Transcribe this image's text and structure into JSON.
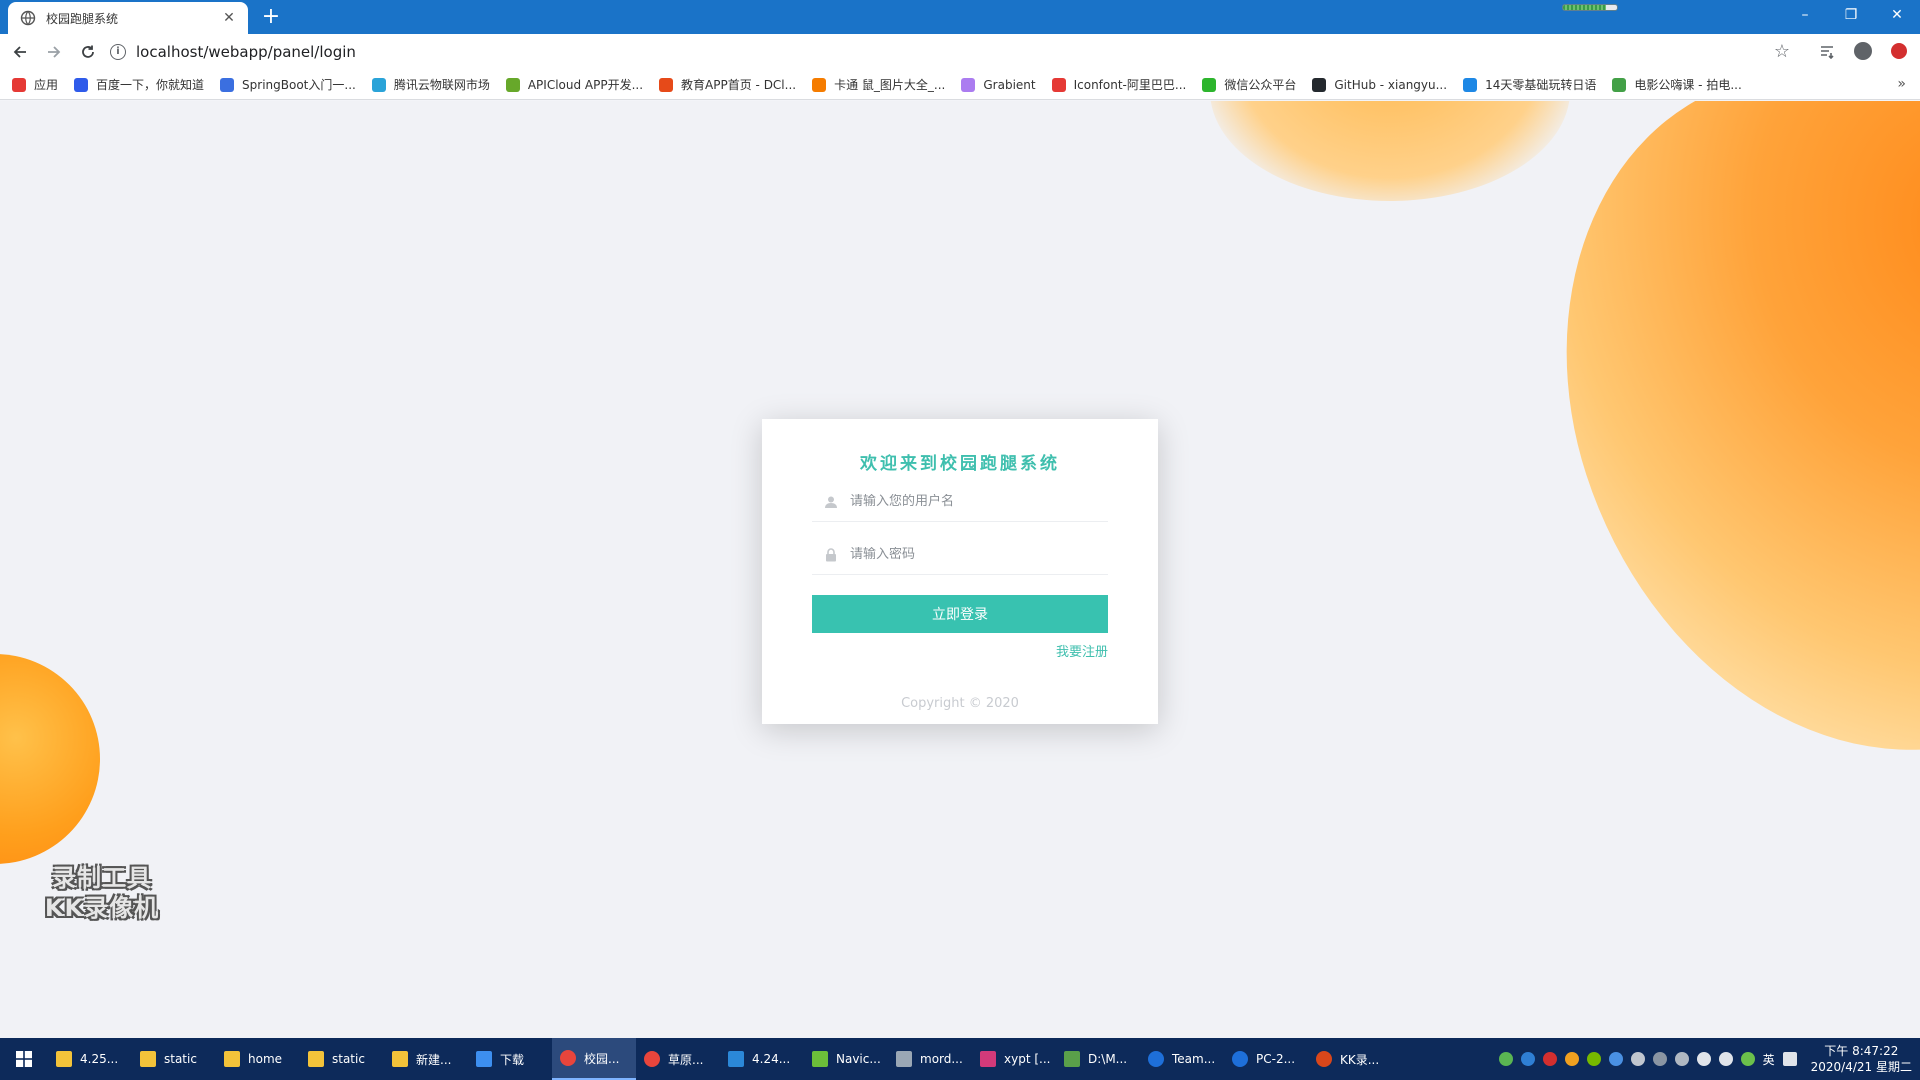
{
  "browser": {
    "tab_title": "校园跑腿系统",
    "new_tab_symbol": "+",
    "url": "localhost/webapp/panel/login",
    "window_controls": [
      "–",
      "❐",
      "✕"
    ],
    "bookmarks": [
      {
        "label": "应用",
        "icon": "apps-grid-icon",
        "color": "#e53935"
      },
      {
        "label": "百度一下，你就知道",
        "icon": "baidu-icon",
        "color": "#2f5bea"
      },
      {
        "label": "SpringBoot入门一...",
        "icon": "springboot-icon",
        "color": "#3b6fe0"
      },
      {
        "label": "腾讯云物联网市场",
        "icon": "cloud-icon",
        "color": "#2aa3d8"
      },
      {
        "label": "APICloud APP开发...",
        "icon": "apicloud-icon",
        "color": "#67a82a"
      },
      {
        "label": "教育APP首页 - DCl...",
        "icon": "dcloud-icon",
        "color": "#e64a19"
      },
      {
        "label": "卡通 鼠_图片大全_...",
        "icon": "image-icon",
        "color": "#f57c00"
      },
      {
        "label": "Grabient",
        "icon": "grabient-icon",
        "color": "#ab7cf0"
      },
      {
        "label": "Iconfont-阿里巴巴...",
        "icon": "iconfont-icon",
        "color": "#e53935"
      },
      {
        "label": "微信公众平台",
        "icon": "wechat-icon",
        "color": "#2db52d"
      },
      {
        "label": "GitHub - xiangyu...",
        "icon": "github-icon",
        "color": "#24292e"
      },
      {
        "label": "14天零基础玩转日语",
        "icon": "bookmark-icon",
        "color": "#1e88e5"
      },
      {
        "label": "电影公嗨课 - 拍电...",
        "icon": "e-icon",
        "color": "#43a047"
      }
    ],
    "bookmarks_more": "»"
  },
  "login": {
    "title": "欢迎来到校园跑腿系统",
    "username_placeholder": "请输入您的用户名",
    "password_placeholder": "请输入密码",
    "submit_label": "立即登录",
    "register_label": "我要注册",
    "copyright": "Copyright © 2020"
  },
  "watermark": {
    "line1": "录制工具",
    "line2": "KK录像机"
  },
  "taskbar": {
    "items": [
      {
        "label": "4.25...",
        "icon": "folder-icon",
        "color": "#f3c33a",
        "active": false
      },
      {
        "label": "static",
        "icon": "folder-icon",
        "color": "#f3c33a",
        "active": false
      },
      {
        "label": "home",
        "icon": "folder-icon",
        "color": "#f3c33a",
        "active": false
      },
      {
        "label": "static",
        "icon": "folder-icon",
        "color": "#f3c33a",
        "active": false
      },
      {
        "label": "新建...",
        "icon": "folder-icon",
        "color": "#f3c33a",
        "active": false
      },
      {
        "label": "下载",
        "icon": "download-icon",
        "color": "#3d8ff0",
        "active": false
      },
      {
        "label": "校园...",
        "icon": "chrome-icon",
        "color": "#e8453c",
        "active": true
      },
      {
        "label": "草原...",
        "icon": "chrome-icon",
        "color": "#e8453c",
        "active": false
      },
      {
        "label": "4.24...",
        "icon": "vscode-icon",
        "color": "#2b88d8",
        "active": false
      },
      {
        "label": "Navic...",
        "icon": "navicat-icon",
        "color": "#6bbf3a",
        "active": false
      },
      {
        "label": "mord...",
        "icon": "notepad-icon",
        "color": "#9aa7b5",
        "active": false
      },
      {
        "label": "xypt [...",
        "icon": "idea-icon",
        "color": "#d23a7a",
        "active": false
      },
      {
        "label": "D:\\M...",
        "icon": "editor-icon",
        "color": "#5aa04a",
        "active": false
      },
      {
        "label": "Team...",
        "icon": "teamviewer-icon",
        "color": "#1e6fd9",
        "active": false
      },
      {
        "label": "PC-2...",
        "icon": "teamviewer-icon",
        "color": "#1e6fd9",
        "active": false
      },
      {
        "label": "KK录...",
        "icon": "kk-recorder-icon",
        "color": "#d9471b",
        "active": false
      }
    ],
    "ime": "英",
    "time": "下午 8:47:22",
    "date": "2020/4/21 星期二"
  }
}
